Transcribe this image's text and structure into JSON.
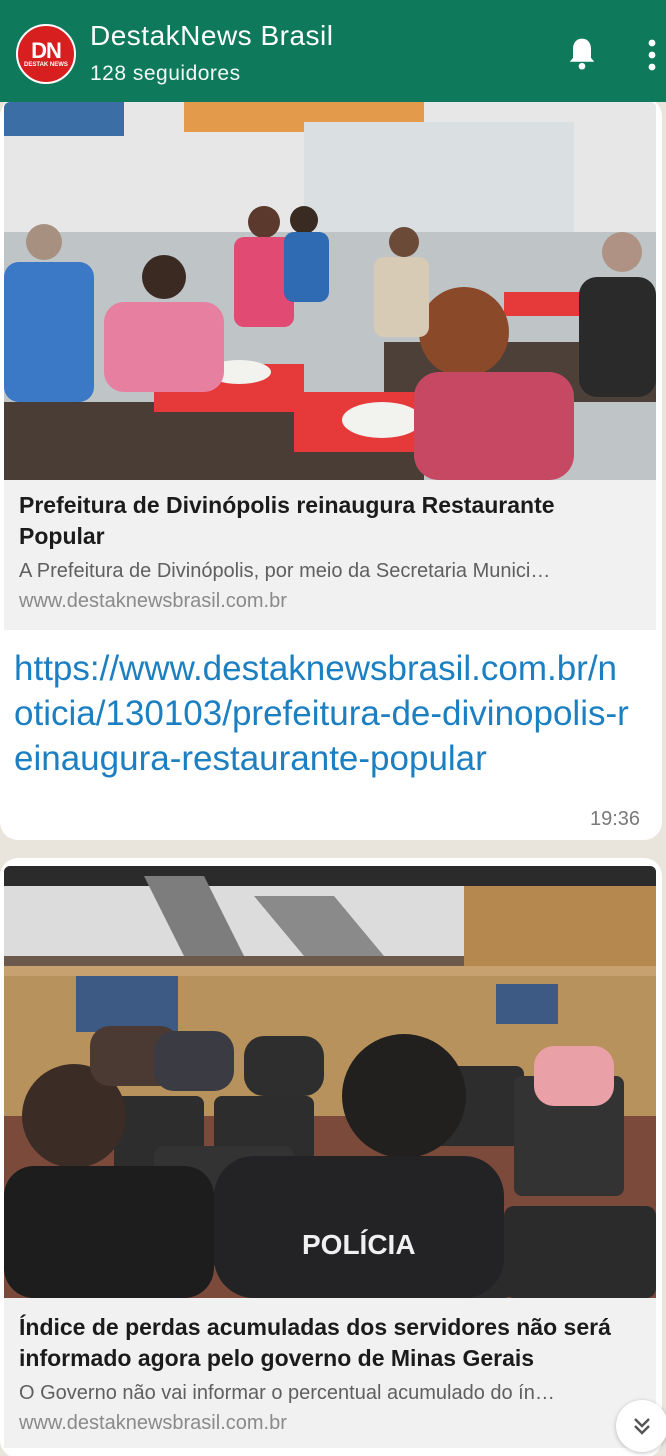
{
  "header": {
    "channel_name": "DestakNews Brasil",
    "followers": "128 seguidores",
    "avatar_letters": "DN",
    "avatar_small": "DESTAK NEWS"
  },
  "messages": [
    {
      "preview_title": "Prefeitura de Divinópolis reinaugura Restaurante Popular",
      "preview_description": "A Prefeitura de Divinópolis, por meio da Secretaria Munici…",
      "preview_domain": "www.destaknewsbrasil.com.br",
      "link": "https://www.destaknewsbrasil.com.br/noticia/130103/prefeitura-de-divinopolis-reinaugura-restaurante-popular",
      "time": "19:36"
    },
    {
      "preview_title": "Índice de perdas acumuladas dos servidores não será informado agora pelo governo de Minas Gerais",
      "preview_description": "O Governo não vai informar o percentual acumulado do ín…",
      "preview_domain": "www.destaknewsbrasil.com.br",
      "shirt_text": "POLÍCIA"
    }
  ],
  "colors": {
    "header": "#0e7a5b",
    "link": "#1b7fc1"
  },
  "icons": [
    "bell-icon",
    "more-options-icon",
    "scroll-down-icon"
  ]
}
